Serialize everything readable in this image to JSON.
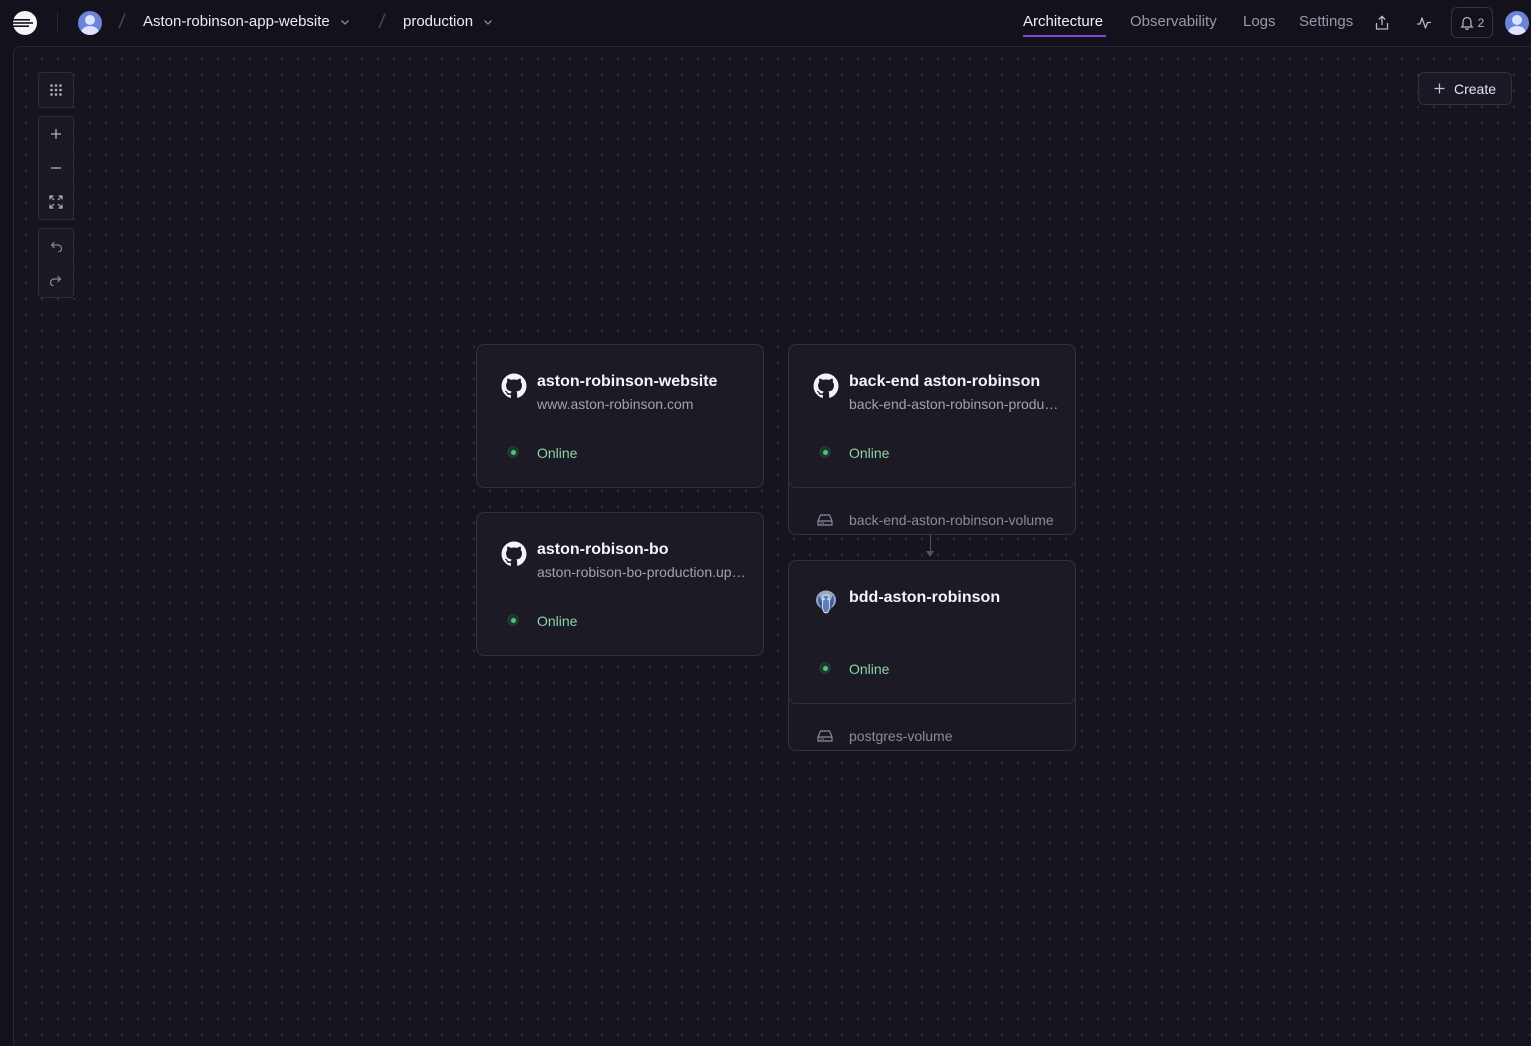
{
  "header": {
    "project_name": "Aston-robinson-app-website",
    "environment": "production",
    "tabs": [
      {
        "label": "Architecture",
        "active": true
      },
      {
        "label": "Observability",
        "active": false
      },
      {
        "label": "Logs",
        "active": false
      },
      {
        "label": "Settings",
        "active": false
      }
    ],
    "notification_count": "2",
    "icons": {
      "logo": "railway-logo-icon",
      "share": "share-icon",
      "activity": "activity-icon",
      "bell": "bell-icon"
    }
  },
  "canvas": {
    "create_label": "Create",
    "toolbar": [
      "grid-icon",
      "zoom-in-icon",
      "zoom-out-icon",
      "fit-view-icon",
      "undo-icon",
      "redo-icon"
    ]
  },
  "services": [
    {
      "name": "aston-robinson-website",
      "subtitle": "www.aston-robinson.com",
      "status": "Online",
      "icon": "github-icon"
    },
    {
      "name": "aston-robison-bo",
      "subtitle": "aston-robison-bo-production.up.railway.app",
      "status": "Online",
      "icon": "github-icon"
    },
    {
      "name": "back-end aston-robinson",
      "subtitle": "back-end-aston-robinson-production.up.railway.app",
      "status": "Online",
      "icon": "github-icon",
      "volume": "back-end-aston-robinson-volume"
    },
    {
      "name": "bdd-aston-robinson",
      "subtitle": "",
      "status": "Online",
      "icon": "postgres-icon",
      "volume": "postgres-volume"
    }
  ],
  "colors": {
    "background": "#13111c",
    "accent": "#7c4bd6",
    "online": "#4fc17b"
  }
}
